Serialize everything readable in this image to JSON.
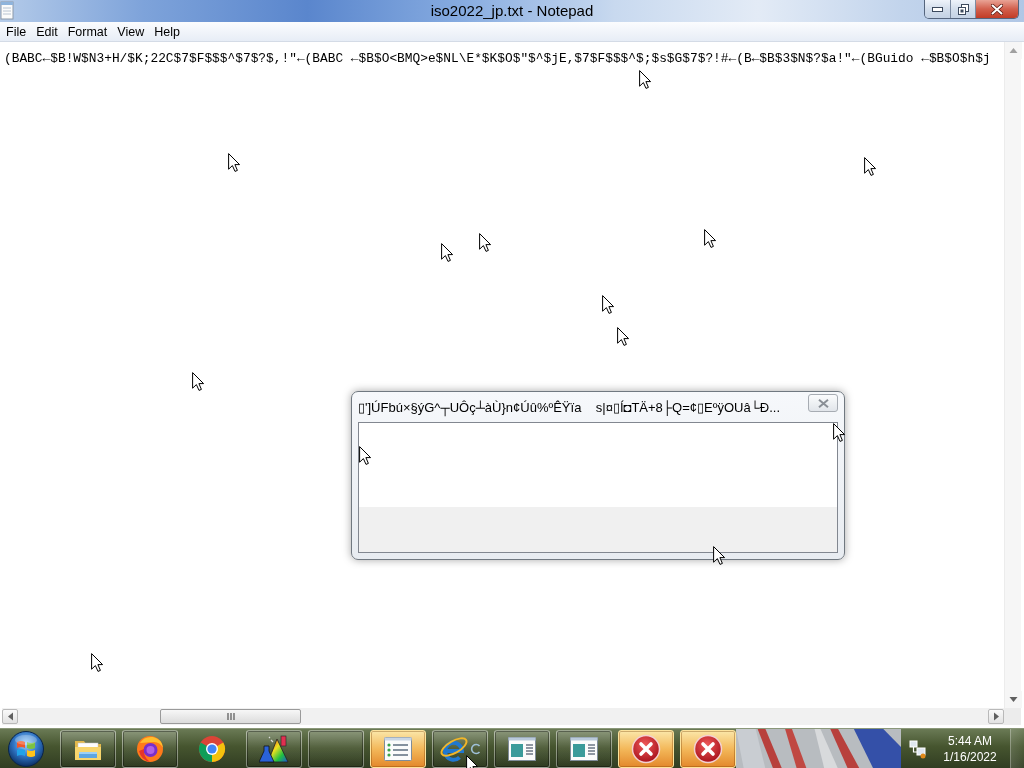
{
  "window": {
    "title": "iso2022_jp.txt - Notepad"
  },
  "menu": [
    "File",
    "Edit",
    "Format",
    "View",
    "Help"
  ],
  "editor": {
    "text": "(BABC←$B!W$N3+H/$K;22C$7$F$$$^$7$?$,!\"←(BABC ←$B$O<BMQ>e$NL\\E*$K$O$\"$^$jE,$7$F$$$^$;$s$G$7$?!#←(B←$B$3$N$?$a!\"←(BGuido ←$B$O$h$j"
  },
  "dialog": {
    "title": "▯']ÚFbú×§ýG^┬UÔç┴àÙ}n¢Úû%ºÊŸïa    s|¤▯Í◘TÄ+8├Q=¢▯EºÿOUâ└Ð..."
  },
  "taskbar": {
    "buttons": [
      {
        "kind": "folder",
        "running": true,
        "flashing": false
      },
      {
        "kind": "fox",
        "running": true,
        "flashing": false
      },
      {
        "kind": "segmented",
        "running": false,
        "flashing": false
      },
      {
        "kind": "flask",
        "running": true,
        "flashing": false
      },
      {
        "kind": "blank",
        "running": true,
        "flashing": false
      },
      {
        "kind": "list",
        "running": true,
        "flashing": true
      },
      {
        "kind": "letter-e",
        "running": true,
        "flashing": false
      },
      {
        "kind": "window",
        "running": true,
        "flashing": false
      },
      {
        "kind": "window",
        "running": true,
        "flashing": false
      },
      {
        "kind": "error",
        "running": true,
        "flashing": true
      },
      {
        "kind": "error",
        "running": true,
        "flashing": true
      }
    ],
    "clock": {
      "time": "5:44 AM",
      "date": "1/16/2022"
    }
  }
}
